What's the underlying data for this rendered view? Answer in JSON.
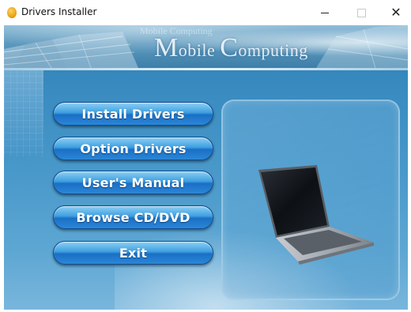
{
  "window": {
    "title": "Drivers Installer",
    "minimize_glyph": "—",
    "maximize_glyph": "☐",
    "close_glyph": "✕"
  },
  "banner": {
    "small_text": "Mobile Computing",
    "brand_M": "M",
    "brand_obile": "obile ",
    "brand_C": "C",
    "brand_omputing": "omputing"
  },
  "menu": {
    "install_drivers": "Install Drivers",
    "option_drivers": "Option Drivers",
    "users_manual": "User's Manual",
    "browse_cd_dvd": "Browse CD/DVD",
    "exit": "Exit"
  },
  "icons": {
    "app": "drivers-installer-icon",
    "preview": "laptop-icon"
  },
  "colors": {
    "button_top": "#8fd0f5",
    "button_bottom": "#1a6fc4",
    "background": "#3a8cc1"
  }
}
